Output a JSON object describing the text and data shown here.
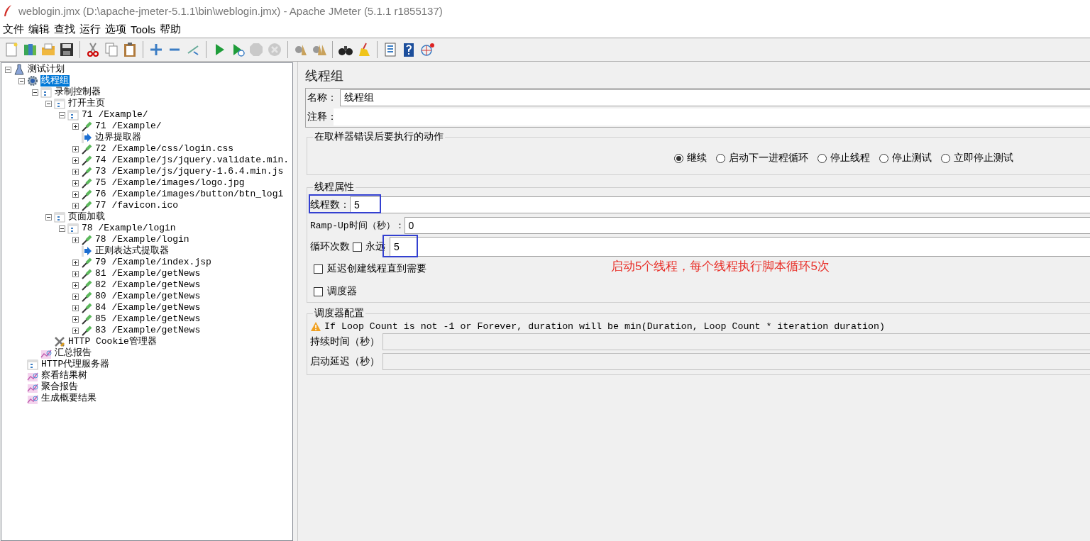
{
  "window": {
    "title": "weblogin.jmx (D:\\apache-jmeter-5.1.1\\bin\\weblogin.jmx) - Apache JMeter (5.1.1 r1855137)"
  },
  "menu": [
    "文件",
    "编辑",
    "查找",
    "运行",
    "选项",
    "Tools",
    "帮助"
  ],
  "toolbar": [
    [
      {
        "kind": "new",
        "disabled": false
      },
      {
        "kind": "templates",
        "disabled": false
      },
      {
        "kind": "open",
        "disabled": false
      },
      {
        "kind": "save",
        "disabled": false
      }
    ],
    [
      {
        "kind": "cut",
        "disabled": false
      },
      {
        "kind": "copy",
        "disabled": false
      },
      {
        "kind": "paste",
        "disabled": false
      }
    ],
    [
      {
        "kind": "add",
        "disabled": false
      },
      {
        "kind": "remove",
        "disabled": false
      },
      {
        "kind": "toggle",
        "disabled": false
      }
    ],
    [
      {
        "kind": "start",
        "disabled": false
      },
      {
        "kind": "start_no_pause",
        "disabled": false
      },
      {
        "kind": "stop",
        "disabled": true
      },
      {
        "kind": "shutdown",
        "disabled": true
      }
    ],
    [
      {
        "kind": "clear",
        "disabled": false
      },
      {
        "kind": "clear_all",
        "disabled": false
      }
    ],
    [
      {
        "kind": "search",
        "disabled": false
      },
      {
        "kind": "reset_search",
        "disabled": false
      }
    ],
    [
      {
        "kind": "log",
        "disabled": false
      },
      {
        "kind": "help",
        "disabled": false
      },
      {
        "kind": "remote",
        "disabled": false
      }
    ]
  ],
  "tree": [
    {
      "label": "测试计划",
      "kind": "plan",
      "expanded": true,
      "selected": false,
      "children": [
        {
          "label": "线程组",
          "kind": "thread_group",
          "expanded": true,
          "selected": true,
          "children": [
            {
              "label": "录制控制器",
              "kind": "controller",
              "expanded": true,
              "selected": false,
              "children": [
                {
                  "label": "打开主页",
                  "kind": "controller",
                  "expanded": true,
                  "selected": false,
                  "children": [
                    {
                      "label": "71 /Example/",
                      "kind": "controller",
                      "expanded": true,
                      "selected": false,
                      "children": [
                        {
                          "label": "71 /Example/",
                          "kind": "sampler",
                          "expanded": false,
                          "selected": false
                        },
                        {
                          "label": "边界提取器",
                          "kind": "extractor",
                          "selected": false
                        },
                        {
                          "label": "72 /Example/css/login.css",
                          "kind": "sampler",
                          "expanded": false,
                          "selected": false
                        },
                        {
                          "label": "74 /Example/js/jquery.validate.min.",
                          "kind": "sampler",
                          "expanded": false,
                          "selected": false
                        },
                        {
                          "label": "73 /Example/js/jquery-1.6.4.min.js",
                          "kind": "sampler",
                          "expanded": false,
                          "selected": false
                        },
                        {
                          "label": "75 /Example/images/logo.jpg",
                          "kind": "sampler",
                          "expanded": false,
                          "selected": false
                        },
                        {
                          "label": "76 /Example/images/button/btn_logi",
                          "kind": "sampler",
                          "expanded": false,
                          "selected": false
                        },
                        {
                          "label": "77 /favicon.ico",
                          "kind": "sampler",
                          "expanded": false,
                          "selected": false
                        }
                      ]
                    }
                  ]
                },
                {
                  "label": "页面加载",
                  "kind": "controller",
                  "expanded": true,
                  "selected": false,
                  "children": [
                    {
                      "label": "78 /Example/login",
                      "kind": "controller",
                      "expanded": true,
                      "selected": false,
                      "children": [
                        {
                          "label": "78 /Example/login",
                          "kind": "sampler",
                          "expanded": false,
                          "selected": false
                        },
                        {
                          "label": "正则表达式提取器",
                          "kind": "extractor",
                          "selected": false
                        },
                        {
                          "label": "79 /Example/index.jsp",
                          "kind": "sampler",
                          "expanded": false,
                          "selected": false
                        },
                        {
                          "label": "81 /Example/getNews",
                          "kind": "sampler",
                          "expanded": false,
                          "selected": false
                        },
                        {
                          "label": "82 /Example/getNews",
                          "kind": "sampler",
                          "expanded": false,
                          "selected": false
                        },
                        {
                          "label": "80 /Example/getNews",
                          "kind": "sampler",
                          "expanded": false,
                          "selected": false
                        },
                        {
                          "label": "84 /Example/getNews",
                          "kind": "sampler",
                          "expanded": false,
                          "selected": false
                        },
                        {
                          "label": "85 /Example/getNews",
                          "kind": "sampler",
                          "expanded": false,
                          "selected": false
                        },
                        {
                          "label": "83 /Example/getNews",
                          "kind": "sampler",
                          "expanded": false,
                          "selected": false
                        }
                      ]
                    }
                  ]
                },
                {
                  "label": "HTTP Cookie管理器",
                  "kind": "config",
                  "selected": false
                }
              ]
            },
            {
              "label": "汇总报告",
              "kind": "listener",
              "selected": false
            }
          ]
        },
        {
          "label": "HTTP代理服务器",
          "kind": "controller",
          "selected": false
        },
        {
          "label": "察看结果树",
          "kind": "listener",
          "selected": false
        },
        {
          "label": "聚合报告",
          "kind": "listener",
          "selected": false
        },
        {
          "label": "生成概要结果",
          "kind": "listener",
          "selected": false
        }
      ]
    }
  ],
  "editor": {
    "title": "线程组",
    "name": {
      "label": "名称：",
      "value": "线程组"
    },
    "comment": {
      "label": "注释："
    },
    "error_action": {
      "legend": "在取样器错误后要执行的动作",
      "options": [
        {
          "label": "继续",
          "selected": true
        },
        {
          "label": "启动下一进程循环",
          "selected": false
        },
        {
          "label": "停止线程",
          "selected": false
        },
        {
          "label": "停止测试",
          "selected": false
        },
        {
          "label": "立即停止测试",
          "selected": false
        }
      ]
    },
    "thread_properties": {
      "legend": "线程属性",
      "threads": {
        "label": "线程数：",
        "value": "5",
        "highlighted": true
      },
      "ramp_up": {
        "label": "Ramp-Up时间（秒）：",
        "value": "0"
      },
      "loop": {
        "label": "循环次数",
        "forever": {
          "label": "永远",
          "checked": false
        },
        "value": "5",
        "highlighted": true
      },
      "checkboxes": [
        {
          "label": "延迟创建线程直到需要",
          "checked": false
        },
        {
          "label": "调度器",
          "checked": false
        }
      ]
    },
    "scheduler": {
      "legend": "调度器配置",
      "warning": "If Loop Count is not -1 or Forever, duration will be min(Duration, Loop Count * iteration duration)",
      "fields": [
        {
          "label": "持续时间（秒）",
          "disabled": true
        },
        {
          "label": "启动延迟（秒）",
          "disabled": true
        }
      ]
    },
    "annotation": {
      "text": "启动5个线程，每个线程执行脚本循环5次"
    }
  }
}
